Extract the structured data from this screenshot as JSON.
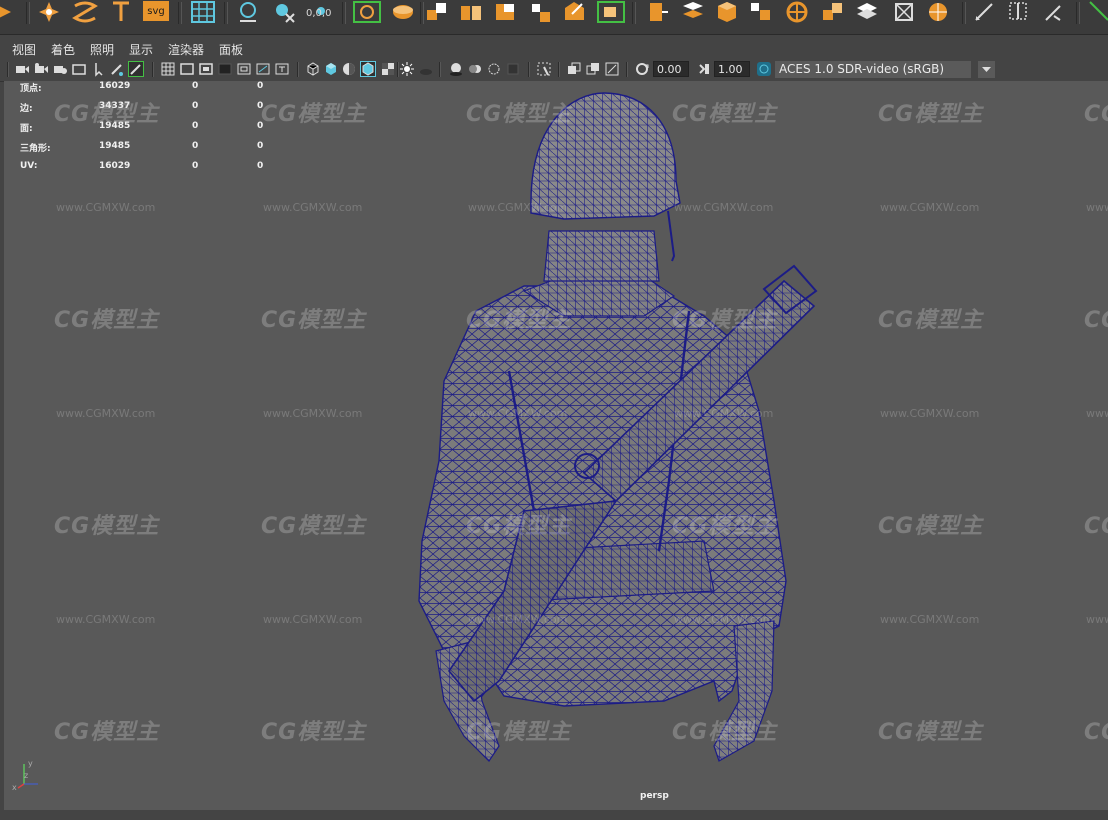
{
  "shelf": {
    "coord_text": "0,0,0",
    "svg_label": "svg",
    "icons": [
      "polygon-star-icon",
      "sweep-mesh-icon",
      "type-icon",
      "svg-icon",
      "grid-icon",
      "view-icon",
      "clear-icon",
      "snap-together-icon",
      "lasso-icon",
      "sculpt-icon",
      "combine-icon",
      "separate-icon",
      "extract-icon",
      "smooth-icon",
      "bevel-icon",
      "bridge-icon",
      "extrude-icon",
      "bool-icon",
      "fill-hole-icon",
      "merge-icon",
      "target-weld-icon",
      "multi-cut-icon",
      "mirror-icon",
      "quad-draw-icon",
      "pen-icon"
    ]
  },
  "panel_menu": {
    "view": "视图",
    "shading": "着色",
    "lighting": "照明",
    "show": "显示",
    "renderer": "渲染器",
    "panels": "面板"
  },
  "toolbar": {
    "exposure_value": "0.00",
    "gamma_value": "1.00",
    "color_space": "ACES 1.0 SDR-video (sRGB)"
  },
  "hud": {
    "rows": [
      {
        "label": "顶点:",
        "count": "16029",
        "a": "0",
        "b": "0"
      },
      {
        "label": "边:",
        "count": "34337",
        "a": "0",
        "b": "0"
      },
      {
        "label": "面:",
        "count": "19485",
        "a": "0",
        "b": "0"
      },
      {
        "label": "三角形:",
        "count": "19485",
        "a": "0",
        "b": "0"
      },
      {
        "label": "UV:",
        "count": "16029",
        "a": "0",
        "b": "0"
      }
    ]
  },
  "watermark": {
    "brand": "CG模型主",
    "url": "www.CGMXW.com"
  },
  "viewport": {
    "camera": "persp",
    "axis_x": "x",
    "axis_y": "y",
    "axis_z": "z"
  },
  "colors": {
    "wire": "#1c1c86",
    "viewport_bg": "#595959",
    "accent_teal": "#3cc0d0",
    "accent_orange": "#f0a040"
  }
}
